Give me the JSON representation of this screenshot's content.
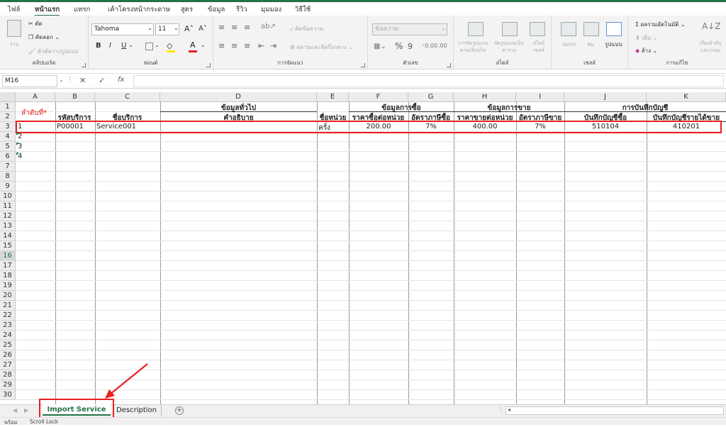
{
  "ribbon_tabs": [
    "ไฟล์",
    "หน้าแรก",
    "แทรก",
    "เค้าโครงหน้ากระดาษ",
    "สูตร",
    "ข้อมูล",
    "รีวิว",
    "มุมมอง",
    "วิธีใช้"
  ],
  "clipboard": {
    "paste": "วาง",
    "cut": "ตัด",
    "copy": "คัดลอก",
    "format_painter": "ตัวคัดวางรูปแบบ",
    "label": "คลิปบอร์ด"
  },
  "font": {
    "name": "Tahoma",
    "size": "11",
    "grow": "A",
    "shrink": "A",
    "bold": "B",
    "italic": "I",
    "underline": "U",
    "label": "ฟอนต์"
  },
  "alignment": {
    "wrap": "ตัดข้อความ",
    "merge": "ผสานและจัดกึ่งกลาง",
    "label": "การจัดแนว"
  },
  "number": {
    "format": "ข้อความ",
    "percent": "%",
    "comma": "9",
    "label": "ตัวเลข"
  },
  "styles": {
    "conditional": "การจัดรูปแบบตามเงื่อนไข",
    "table": "จัดรูปแบบเป็นตาราง",
    "cell": "สไตล์เซลล์",
    "label": "สไตล์"
  },
  "cells": {
    "insert": "แทรก",
    "delete": "ลบ",
    "format": "รูปแบบ",
    "label": "เซลล์"
  },
  "editing": {
    "autosum": "ผลรวมอัตโนมัติ",
    "fill": "เติม",
    "clear": "ล้าง",
    "sort": "เรียงลำดับและกรอง",
    "label": "การแก้ไข"
  },
  "formula_bar": {
    "name_box": "M16",
    "fx": "fx",
    "cancel": "✕",
    "enter": "✓"
  },
  "columns": [
    "A",
    "B",
    "C",
    "D",
    "E",
    "F",
    "G",
    "H",
    "I",
    "J",
    "K"
  ],
  "row_numbers": [
    "1",
    "2",
    "3",
    "4",
    "5",
    "6",
    "7",
    "8",
    "9",
    "10",
    "11",
    "12",
    "13",
    "14",
    "15",
    "16",
    "17",
    "18",
    "19",
    "20",
    "21",
    "22",
    "23",
    "24",
    "25",
    "26",
    "27",
    "28",
    "29",
    "30"
  ],
  "group_headers": {
    "general": "ข้อมูลทั่วไป",
    "purchase": "ข้อมูลการซื้อ",
    "sales": "ข้อมูลการขาย",
    "accounting": "การบันทึกบัญชี"
  },
  "order_label": "ลำดับที่*",
  "sub_headers": [
    "รหัสบริการ",
    "ชื่อบริการ",
    "คำอธิบาย",
    "ชื่อหน่วย",
    "ราคาซื้อต่อหน่วย",
    "อัตราภาษีซื้อ",
    "ราคาขายต่อหน่วย",
    "อัตราภาษีขาย",
    "บันทึกบัญชีซื้อ",
    "บันทึกบัญชีรายได้ขาย"
  ],
  "data_row": {
    "no": "1",
    "code": "P00001",
    "name": "Service001",
    "unit": "ครั้ง",
    "buy_price": "200.00",
    "buy_tax": "7%",
    "sell_price": "400.00",
    "sell_tax": "7%",
    "buy_account": "510104",
    "sell_account": "410201"
  },
  "order_numbers": [
    "2",
    "3",
    "4"
  ],
  "sheets": [
    "Import Service",
    "Description"
  ],
  "status": {
    "ready": "พร้อม",
    "scroll": "Scroll Lock"
  },
  "colors": {
    "accent": "#217346",
    "highlight": "#e8211f"
  }
}
